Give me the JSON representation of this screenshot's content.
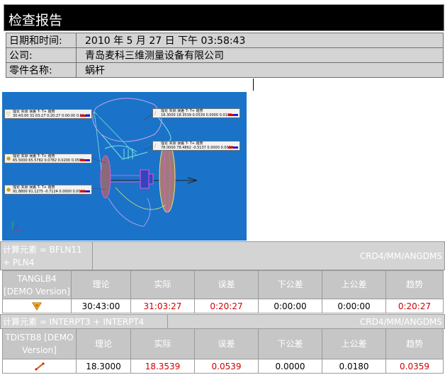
{
  "report": {
    "title": "检查报告",
    "info": [
      {
        "key": "日期和时间:",
        "value": "2010 年 5 月 27 日  下午 03:58:43"
      },
      {
        "key": "公司:",
        "value": "青岛麦科三维测量设备有限公司"
      },
      {
        "key": "零件名称:",
        "value": "蜗杆"
      }
    ]
  },
  "colors": {
    "scene_bg": "#1a73c9",
    "deviation": "#d00000",
    "header_bg": "#c6c6c6",
    "title_bg": "#000000"
  },
  "cad_labels": [
    {
      "head": "理论  实际  误差  T-  T+  趋势",
      "vals": "30:43:00 31:03:27 0:20:27 0:00:00 0:00:00",
      "icon": "triangle-down-icon"
    },
    {
      "head": "理论  实际  误差  T-  T+  趋势",
      "vals": "18.3000 18.3539 0.0539 0.0000 0.0180",
      "icon": "segment-icon"
    },
    {
      "head": "理论  实际  误差  T-  T+  趋势",
      "vals": "78.0000 78.4862 -0.5137 0.0000 0.0000",
      "icon": "segment-icon"
    },
    {
      "head": "理论  实际  误差  T-  T+  趋势",
      "vals": "65.5000 65.5782 0.0782 0.0200 0.0500",
      "icon": "circle-icon"
    },
    {
      "head": "理论  实际  误差  T-  T+  趋势",
      "vals": "91.8800 91.1275 -0.7124 0.0000 0.0000",
      "icon": "circle-icon"
    }
  ],
  "sections": [
    {
      "calc_left": "计算元素  = BFLN11 + PLN4",
      "calc_right": "CRD4/MM/ANGDMS",
      "name": "TANGLB4 [DEMO Version]",
      "headers": [
        "理论",
        "实际",
        "误差",
        "下公差",
        "上公差",
        "趋势"
      ],
      "icon": "triangle-down-icon",
      "values": [
        "30:43:00",
        "31:03:27",
        "0:20:27",
        "0:00:00",
        "0:00:00",
        "0:20:27"
      ]
    },
    {
      "calc_left": "计算元素  = INTERPT3 + INTERPT4",
      "calc_right": "CRD4/MM/ANGDMS",
      "name": "TDISTB8 [DEMO Version]",
      "headers": [
        "理论",
        "实际",
        "误差",
        "下公差",
        "上公差",
        "趋势"
      ],
      "icon": "segment-icon",
      "values": [
        "18.3000",
        "18.3539",
        "0.0539",
        "0.0000",
        "0.0180",
        "0.0359"
      ]
    }
  ]
}
